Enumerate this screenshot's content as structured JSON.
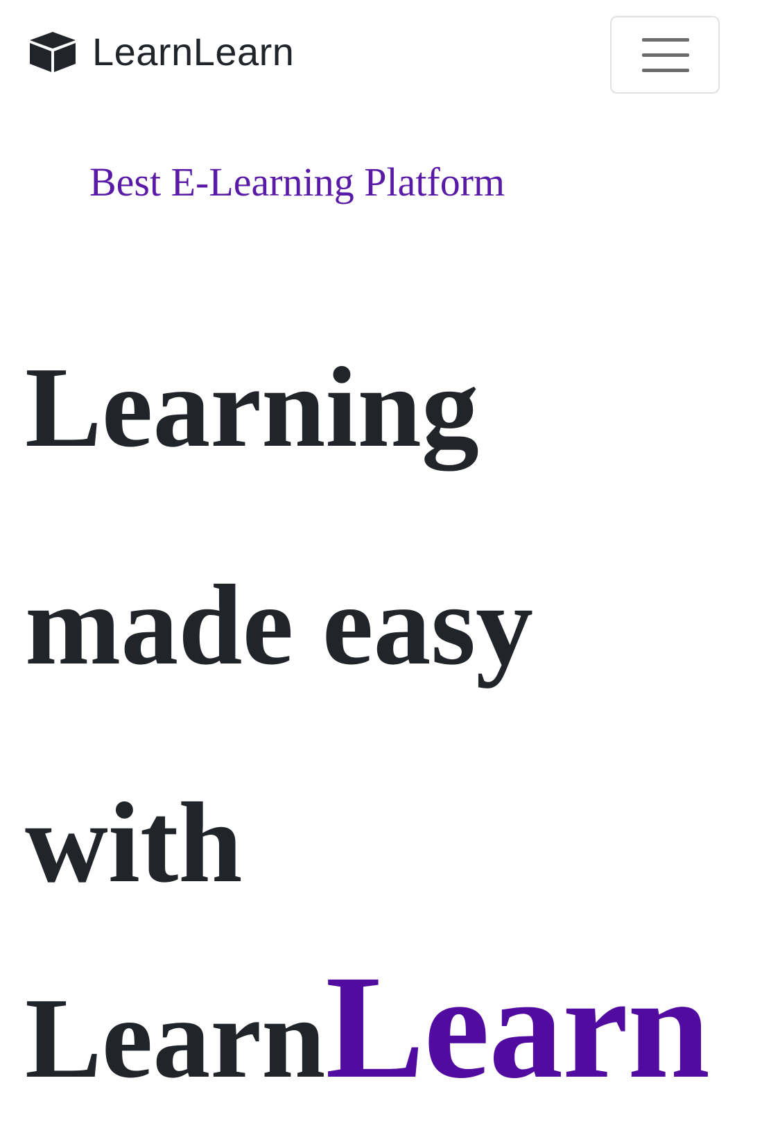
{
  "navbar": {
    "brand_text": "LearnLearn",
    "brand_icon": "box-icon",
    "toggler_icon": "hamburger-menu-icon"
  },
  "hero": {
    "tagline": "Best E-Learning Platform",
    "line_1": "Learning",
    "line_2": "made easy",
    "line_3": "with",
    "line_4_plain": "Learn",
    "line_4_accent": "Learn"
  },
  "colors": {
    "accent": "#520ba0",
    "tagline": "#5a1aa8",
    "text": "#212529",
    "toggler_border": "#dfe1e4"
  }
}
